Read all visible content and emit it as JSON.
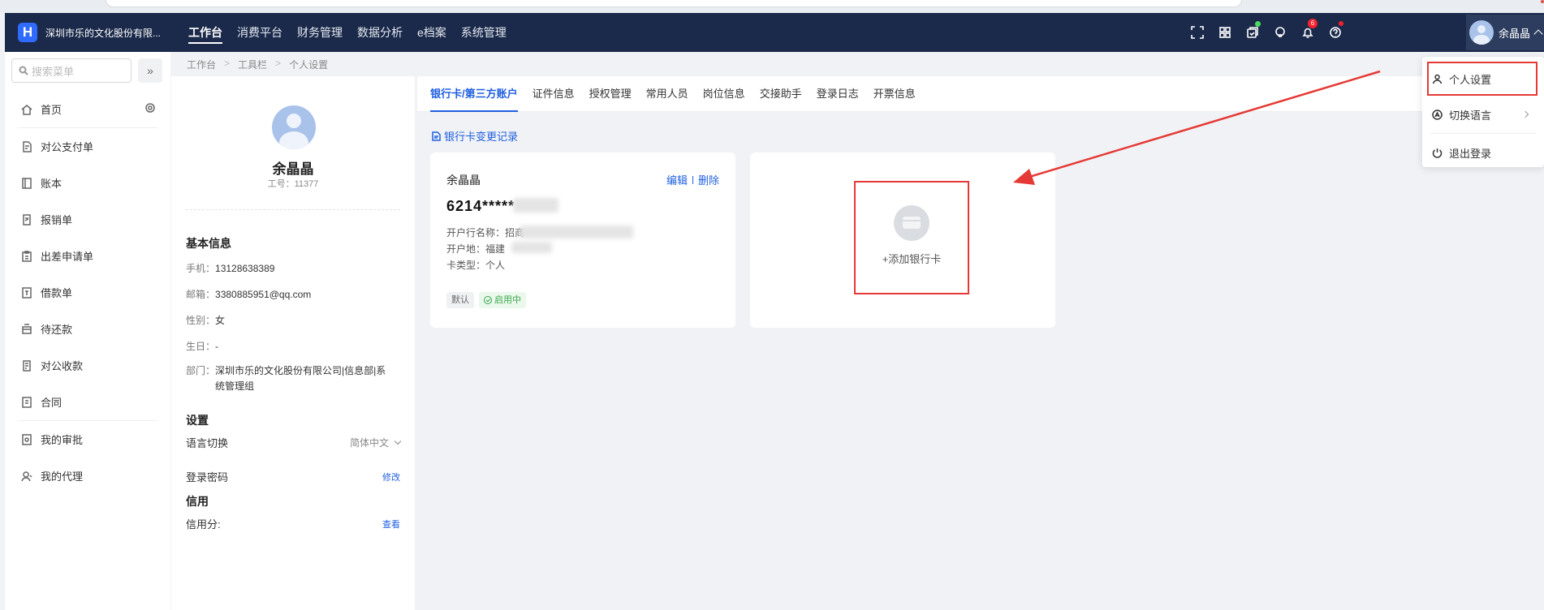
{
  "header": {
    "company": "深圳市乐的文化股份有限...",
    "nav": [
      "工作台",
      "消费平台",
      "财务管理",
      "数据分析",
      "e档案",
      "系统管理"
    ],
    "notify_count": "6",
    "user_name": "余晶晶"
  },
  "sidebar": {
    "search_placeholder": "搜索菜单",
    "items": [
      {
        "label": "首页",
        "icon": "home-icon"
      },
      {
        "label": "对公支付单",
        "icon": "document-icon"
      },
      {
        "label": "账本",
        "icon": "book-icon"
      },
      {
        "label": "报销单",
        "icon": "edit-doc-icon"
      },
      {
        "label": "出差申请单",
        "icon": "clipboard-icon"
      },
      {
        "label": "借款单",
        "icon": "wallet-icon"
      },
      {
        "label": "待还款",
        "icon": "repay-icon"
      },
      {
        "label": "对公收款",
        "icon": "receipt-icon"
      },
      {
        "label": "合同",
        "icon": "contract-icon"
      },
      {
        "label": "我的审批",
        "icon": "approval-icon"
      },
      {
        "label": "我的代理",
        "icon": "agent-icon"
      }
    ]
  },
  "breadcrumb": [
    "工作台",
    "工具栏",
    "个人设置"
  ],
  "profile": {
    "name": "余晶晶",
    "employee_id": "工号：11377",
    "basic_title": "基本信息",
    "phone_label": "手机：",
    "phone": "13128638389",
    "email_label": "邮箱：",
    "email": "3380885951@qq.com",
    "gender_label": "性别：",
    "gender": "女",
    "birthday_label": "生日：",
    "birthday": "-",
    "dept_label": "部门：",
    "dept": "深圳市乐的文化股份有限公司|信息部|系统管理组",
    "settings_title": "设置",
    "lang_label": "语言切换",
    "lang_value": "简体中文",
    "pwd_label": "登录密码",
    "pwd_action": "修改",
    "credit_title": "信用",
    "credit_label": "信用分:",
    "credit_action": "查看"
  },
  "main": {
    "tabs": [
      "银行卡/第三方账户",
      "证件信息",
      "授权管理",
      "常用人员",
      "岗位信息",
      "交接助手",
      "登录日志",
      "开票信息"
    ],
    "change_log": "银行卡变更记录",
    "card": {
      "holder": "余晶晶",
      "edit": "编辑",
      "delete": "删除",
      "number": "6214*****",
      "bank_label": "开户行名称：招商",
      "location_label": "开户地：福建",
      "type_label": "卡类型：个人",
      "tag_default": "默认",
      "tag_status": "启用中"
    },
    "add_card": "+添加银行卡"
  },
  "dropdown": {
    "items": [
      "个人设置",
      "切换语言",
      "退出登录"
    ]
  },
  "colors": {
    "header_bg": "#1b2a4a",
    "accent": "#1f5fe0",
    "annotation_red": "#e53935"
  }
}
